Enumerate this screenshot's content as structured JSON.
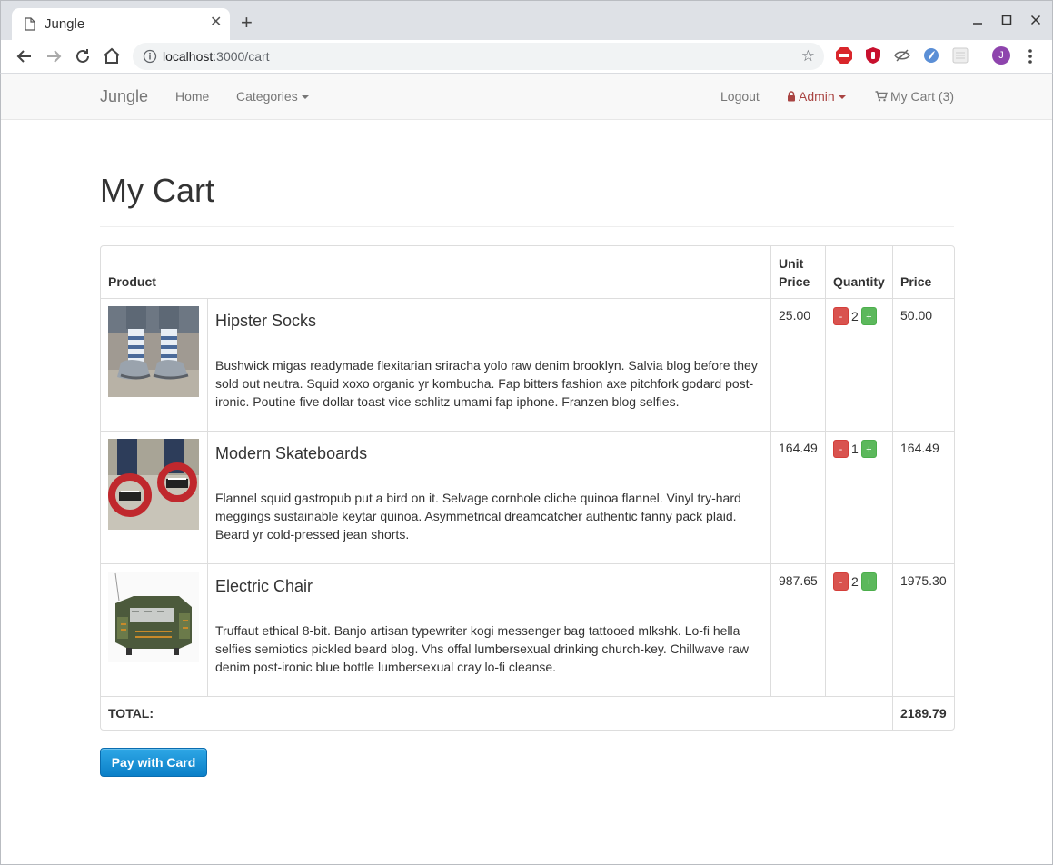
{
  "browser": {
    "tab_title": "Jungle",
    "tab_close": "✕",
    "new_tab": "+",
    "url_host": "localhost",
    "url_rest": ":3000/cart",
    "avatar_letter": "J",
    "star": "☆"
  },
  "navbar": {
    "brand": "Jungle",
    "home": "Home",
    "categories": "Categories",
    "logout": "Logout",
    "admin": "Admin",
    "cart": "My Cart (3)"
  },
  "page": {
    "title": "My Cart"
  },
  "table": {
    "headers": {
      "product": "Product",
      "unit_price": "Unit Price",
      "quantity": "Quantity",
      "price": "Price"
    },
    "rows": [
      {
        "name": "Hipster Socks",
        "description": "Bushwick migas readymade flexitarian sriracha yolo raw denim brooklyn. Salvia blog before they sold out neutra. Squid xoxo organic yr kombucha. Fap bitters fashion axe pitchfork godard post-ironic. Poutine five dollar toast vice schlitz umami fap iphone. Franzen blog selfies.",
        "unit_price": "25.00",
        "quantity": "2",
        "price": "50.00"
      },
      {
        "name": "Modern Skateboards",
        "description": "Flannel squid gastropub put a bird on it. Selvage cornhole cliche quinoa flannel. Vinyl try-hard meggings sustainable keytar quinoa. Asymmetrical dreamcatcher authentic fanny pack plaid. Beard yr cold-pressed jean shorts.",
        "unit_price": "164.49",
        "quantity": "1",
        "price": "164.49"
      },
      {
        "name": "Electric Chair",
        "description": "Truffaut ethical 8-bit. Banjo artisan typewriter kogi messenger bag tattooed mlkshk. Lo-fi hella selfies semiotics pickled beard blog. Vhs offal lumbersexual drinking church-key. Chillwave raw denim post-ironic blue bottle lumbersexual cray lo-fi cleanse.",
        "unit_price": "987.65",
        "quantity": "2",
        "price": "1975.30"
      }
    ],
    "minus_label": "-",
    "plus_label": "+",
    "total_label": "TOTAL:",
    "total_value": "2189.79"
  },
  "pay_button": "Pay with Card",
  "colors": {
    "minus_btn": "#d9534f",
    "plus_btn": "#5cb85c",
    "admin_text": "#a94442",
    "pay_btn": "#1b8fd6"
  }
}
